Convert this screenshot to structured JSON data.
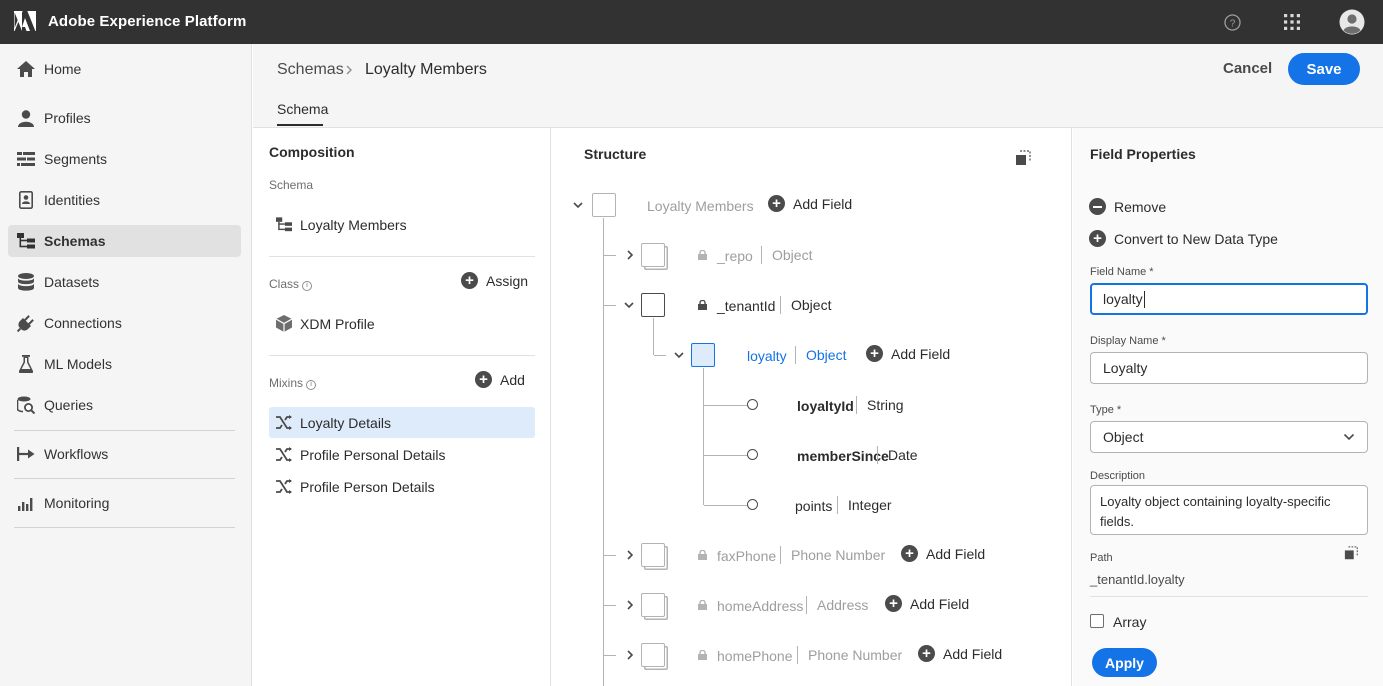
{
  "app": {
    "title": "Adobe Experience Platform"
  },
  "topbar_icons": [
    "help-icon",
    "app-switcher-icon",
    "user-avatar-icon"
  ],
  "sidebar": {
    "items": [
      {
        "label": "Home",
        "icon": "home-icon"
      },
      {
        "label": "Profiles",
        "icon": "user-icon"
      },
      {
        "label": "Segments",
        "icon": "segments-icon"
      },
      {
        "label": "Identities",
        "icon": "identity-card-icon"
      },
      {
        "label": "Schemas",
        "icon": "schema-icon",
        "active": true
      },
      {
        "label": "Datasets",
        "icon": "database-icon"
      },
      {
        "label": "Connections",
        "icon": "plug-icon"
      },
      {
        "label": "ML Models",
        "icon": "flask-icon"
      },
      {
        "label": "Queries",
        "icon": "query-icon"
      },
      {
        "label": "Workflows",
        "icon": "workflow-icon"
      },
      {
        "label": "Monitoring",
        "icon": "bar-chart-icon"
      }
    ]
  },
  "header": {
    "breadcrumb": [
      "Schemas",
      "Loyalty Members"
    ],
    "cancel_label": "Cancel",
    "save_label": "Save",
    "tab_label": "Schema"
  },
  "composition": {
    "title": "Composition",
    "schema_label": "Schema",
    "schema_name": "Loyalty Members",
    "class_label": "Class",
    "assign_label": "Assign",
    "class_name": "XDM Profile",
    "mixins_label": "Mixins",
    "add_label": "Add",
    "mixins": [
      {
        "label": "Loyalty Details",
        "selected": true
      },
      {
        "label": "Profile Personal Details"
      },
      {
        "label": "Profile Person Details"
      }
    ]
  },
  "structure": {
    "title": "Structure",
    "root": "Loyalty Members",
    "add_field": "Add Field",
    "nodes": [
      {
        "name": "_repo",
        "type": "Object"
      },
      {
        "name": "_tenantId",
        "type": "Object"
      },
      {
        "name": "loyalty",
        "type": "Object"
      },
      {
        "name": "loyaltyId",
        "type": "String"
      },
      {
        "name": "memberSince",
        "type": "Date"
      },
      {
        "name": "points",
        "type": "Integer"
      },
      {
        "name": "faxPhone",
        "type": "Phone Number"
      },
      {
        "name": "homeAddress",
        "type": "Address"
      },
      {
        "name": "homePhone",
        "type": "Phone Number"
      }
    ]
  },
  "properties": {
    "title": "Field Properties",
    "remove_label": "Remove",
    "convert_label": "Convert to New Data Type",
    "field_name_label": "Field Name",
    "field_name_value": "loyalty",
    "display_name_label": "Display Name",
    "display_name_value": "Loyalty",
    "type_label": "Type",
    "type_value": "Object",
    "description_label": "Description",
    "description_value": "Loyalty object containing loyalty-specific fields.",
    "path_label": "Path",
    "path_value": "_tenantId.loyalty",
    "array_label": "Array",
    "apply_label": "Apply",
    "required_mark": "*"
  },
  "colors": {
    "accent": "#1473e6",
    "topbar": "#323232",
    "selected_bg": "#deebfa"
  }
}
